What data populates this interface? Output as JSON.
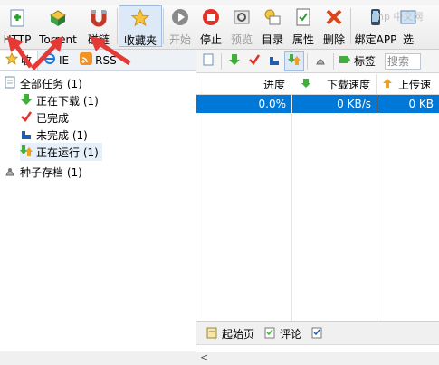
{
  "toolbar": {
    "buttons": [
      {
        "label": "HTTP",
        "icon": "http-icon"
      },
      {
        "label": "Torrent",
        "icon": "torrent-icon"
      },
      {
        "label": "磁链",
        "icon": "magnet-icon"
      },
      {
        "label": "收藏夹",
        "icon": "star-icon"
      },
      {
        "label": "开始",
        "icon": "play-icon"
      },
      {
        "label": "停止",
        "icon": "stop-icon"
      },
      {
        "label": "预览",
        "icon": "preview-icon"
      },
      {
        "label": "目录",
        "icon": "folder-icon"
      },
      {
        "label": "属性",
        "icon": "properties-icon"
      },
      {
        "label": "删除",
        "icon": "delete-icon"
      },
      {
        "label": "绑定APP",
        "icon": "app-icon"
      },
      {
        "label": "选",
        "icon": "select-icon"
      }
    ]
  },
  "left_tabs": [
    {
      "label": "收",
      "icon": "star-icon"
    },
    {
      "label": "IE",
      "icon": "ie-icon"
    },
    {
      "label": "RSS",
      "icon": "rss-icon"
    }
  ],
  "tree": [
    {
      "label": "全部任务 (1)",
      "icon": "all-tasks-icon"
    },
    {
      "label": "正在下载 (1)",
      "icon": "download-arrow-icon"
    },
    {
      "label": "已完成",
      "icon": "check-icon"
    },
    {
      "label": "未完成 (1)",
      "icon": "incomplete-icon"
    },
    {
      "label": "正在运行 (1)",
      "icon": "running-icon"
    },
    {
      "label": "种子存档 (1)",
      "icon": "seed-archive-icon"
    }
  ],
  "right_toolbar": {
    "tag_label": "标签",
    "search_placeholder": "搜索"
  },
  "grid": {
    "headers": [
      "进度",
      "下载速度",
      "上传速"
    ],
    "row": {
      "progress": "0.0%",
      "down_speed": "0 KB/s",
      "up_speed": "0 KB"
    }
  },
  "bottom_tabs": [
    {
      "label": "起始页",
      "icon": "home-icon"
    },
    {
      "label": "评论",
      "icon": "comment-icon"
    }
  ],
  "watermark": "php 中文网",
  "colors": {
    "selection": "#0078d7",
    "arrow": "#e53935"
  }
}
